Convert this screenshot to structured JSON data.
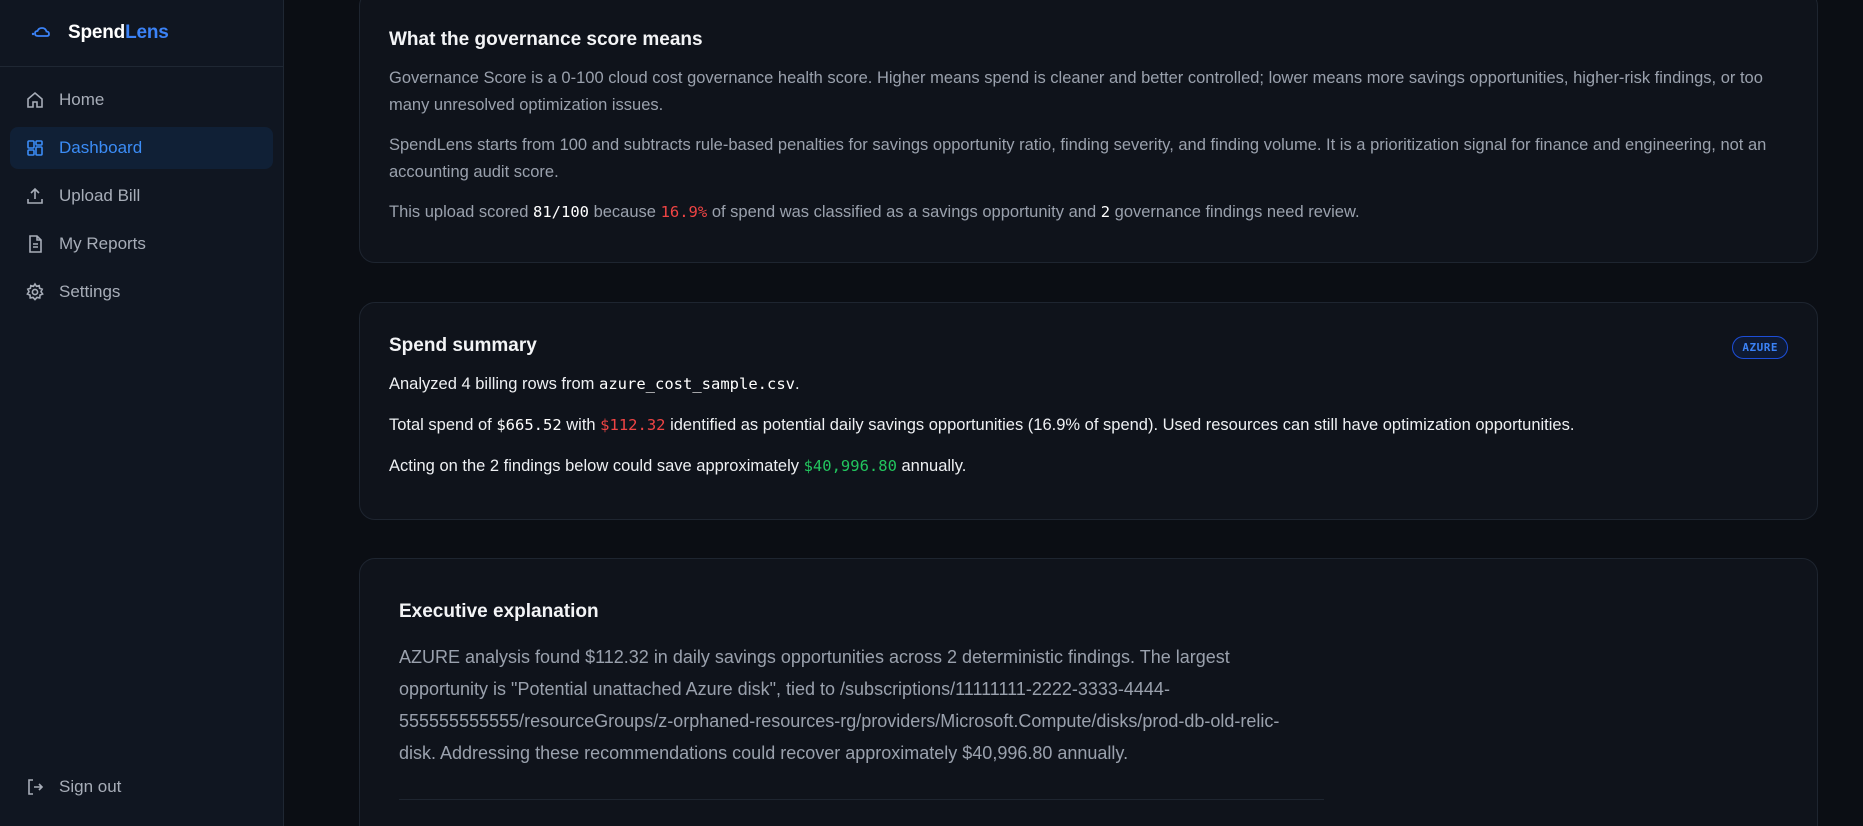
{
  "brand": {
    "name_a": "Spend",
    "name_b": "Lens"
  },
  "sidebar": {
    "items": [
      {
        "label": "Home",
        "icon": "home-icon"
      },
      {
        "label": "Dashboard",
        "icon": "dashboard-icon",
        "active": true
      },
      {
        "label": "Upload Bill",
        "icon": "upload-icon"
      },
      {
        "label": "My Reports",
        "icon": "report-icon"
      },
      {
        "label": "Settings",
        "icon": "gear-icon"
      }
    ],
    "signout": "Sign out"
  },
  "governance": {
    "title": "What the governance score means",
    "p1": "Governance Score is a 0-100 cloud cost governance health score. Higher means spend is cleaner and better controlled; lower means more savings opportunities, higher-risk findings, or too many unresolved optimization issues.",
    "p2": "SpendLens starts from 100 and subtracts rule-based penalties for savings opportunity ratio, finding severity, and finding volume. It is a prioritization signal for finance and engineering, not an accounting audit score.",
    "p3_a": "This upload scored ",
    "score": "81/100",
    "p3_b": " because ",
    "pct": "16.9%",
    "p3_c": " of spend was classified as a savings opportunity and ",
    "findings": "2",
    "p3_d": " governance findings need review."
  },
  "summary": {
    "title": "Spend summary",
    "badge": "AZURE",
    "l1_a": "Analyzed 4 billing rows from ",
    "file": "azure_cost_sample.csv",
    "l1_b": ".",
    "l2_a": "Total spend of ",
    "total": "$665.52",
    "l2_b": " with ",
    "savings": "$112.32",
    "l2_c": " identified as potential daily savings opportunities (16.9% of spend). Used resources can still have optimization opportunities.",
    "l3_a": "Acting on the 2 findings below could save approximately ",
    "annual": "$40,996.80",
    "l3_b": " annually."
  },
  "executive": {
    "title": "Executive explanation",
    "text": "AZURE analysis found $112.32 in daily savings opportunities across 2 deterministic findings. The largest opportunity is \"Potential unattached Azure disk\", tied to /subscriptions/11111111-2222-3333-4444-555555555555/resourceGroups/z-orphaned-resources-rg/providers/Microsoft.Compute/disks/prod-db-old-relic-disk. Addressing these recommendations could recover approximately $40,996.80 annually."
  },
  "colors": {
    "accent": "#3b82f6",
    "danger": "#ef4444",
    "success": "#22c55e"
  }
}
